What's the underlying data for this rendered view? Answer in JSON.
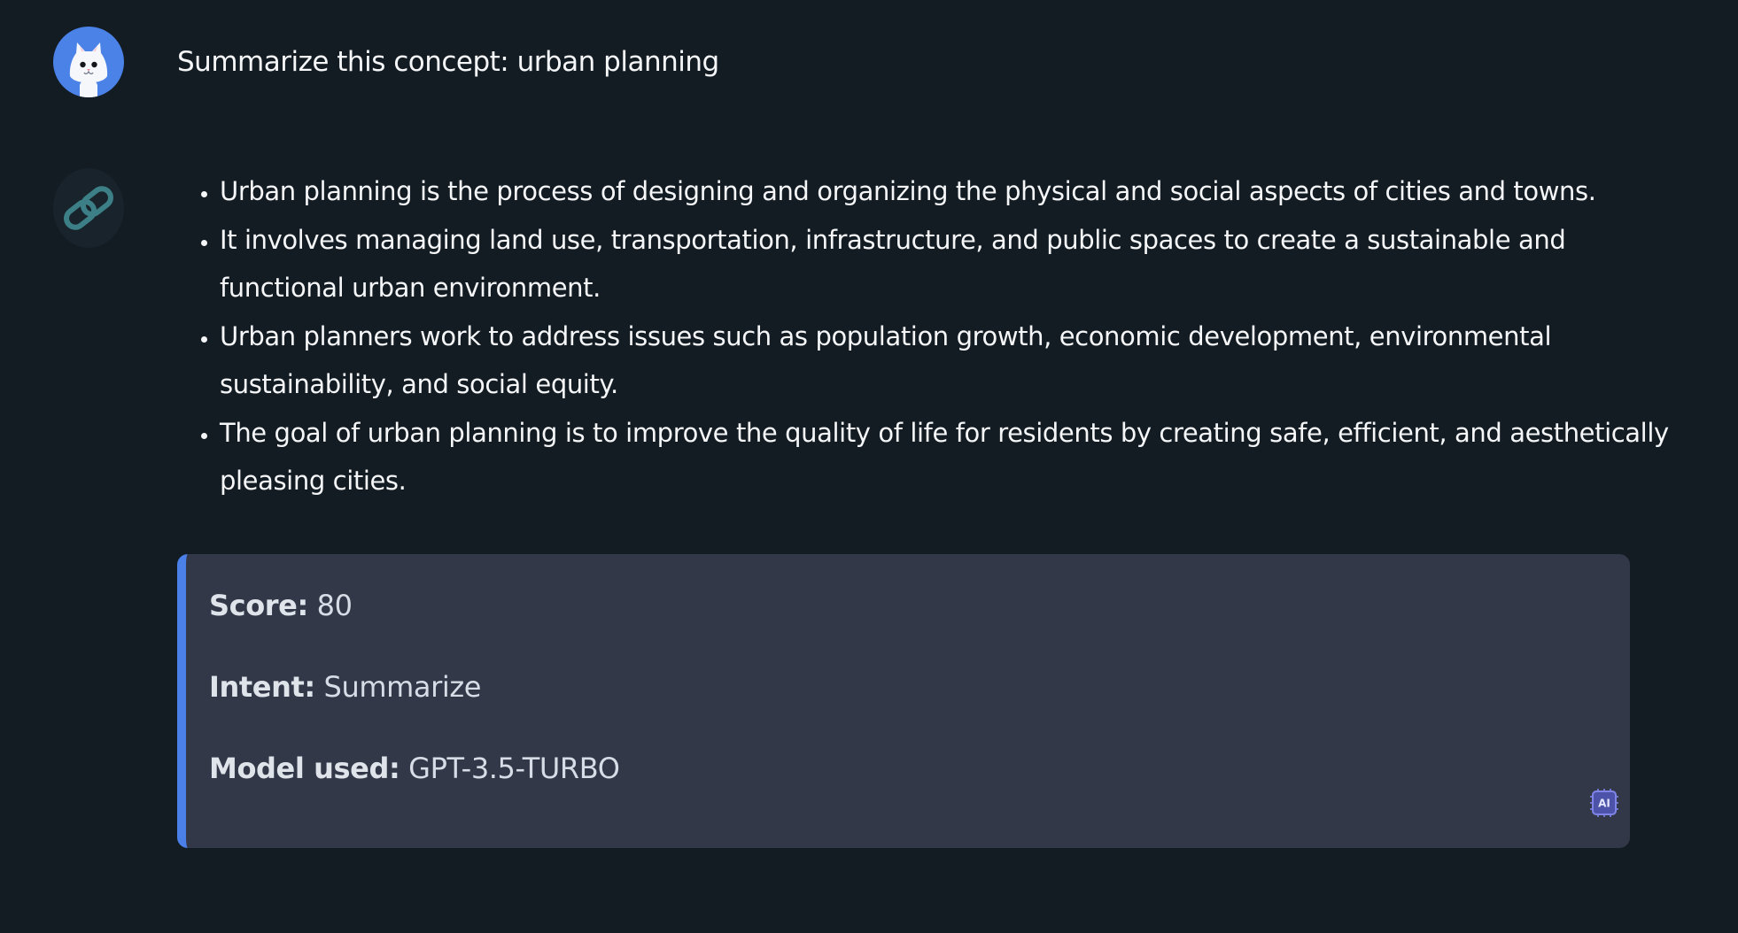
{
  "conversation": {
    "user_prompt": "Summarize this concept: urban planning",
    "response_points": [
      "Urban planning is the process of designing and organizing the physical and social aspects of cities and towns.",
      "It involves managing land use, transportation, infrastructure, and public spaces to create a sustainable and functional urban environment.",
      "Urban planners work to address issues such as population growth, economic development, environmental sustainability, and social equity.",
      "The goal of urban planning is to improve the quality of life for residents by creating safe, efficient, and aesthetically pleasing cities."
    ]
  },
  "metadata_card": {
    "score_label": "Score:",
    "score_value": "80",
    "intent_label": "Intent:",
    "intent_value": "Summarize",
    "model_label": "Model used:",
    "model_value": "GPT-3.5-TURBO",
    "badge_text": "AI"
  },
  "icons": {
    "user_avatar": "cat-avatar-icon",
    "assistant_avatar": "link-icon",
    "badge": "ai-chip-icon"
  },
  "colors": {
    "background": "#141c23",
    "card_background": "#323848",
    "accent": "#4a80e8",
    "assistant_icon": "#3d7f86",
    "badge": "#7f85e6"
  }
}
